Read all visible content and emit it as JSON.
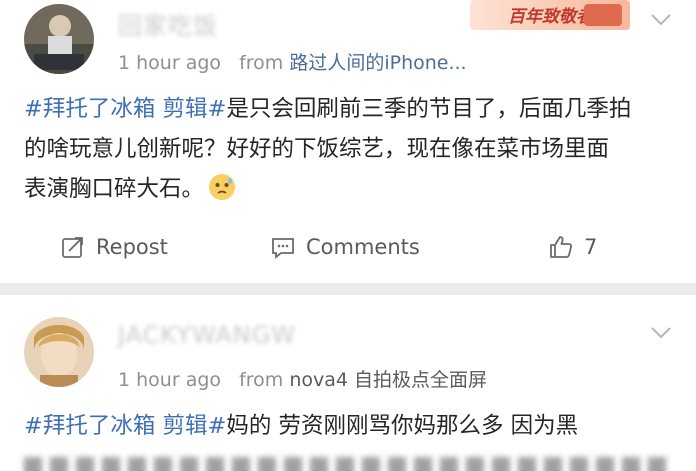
{
  "posts": [
    {
      "username": "回家吃饭",
      "time": "1 hour ago",
      "source_prefix": "from",
      "source_name": "路过人间的iPhone...",
      "badge": "百年致敬者",
      "topic": "#拜托了冰箱 剪辑#",
      "text_line_1_rest": "是只会回刷前三季的节目了，后面几季拍",
      "text_line_2": "的啥玩意儿创新呢？好好的下饭综艺，现在像在菜市场里面",
      "text_line_3": "表演胸口碎大石。",
      "emoji": "sweat-face-emoji",
      "actions": {
        "repost": "Repost",
        "comments": "Comments",
        "likes": "7"
      }
    },
    {
      "username": "JACKYWANGW",
      "time": "1 hour ago",
      "source_prefix": "from",
      "source_name": "nova4 自拍极点全面屏",
      "topic": "#拜托了冰箱 剪辑#",
      "text_line_1_rest": "妈的 劳资刚刚骂你妈那么多 因为黑"
    }
  ],
  "colors": {
    "topic": "#3f6fb7",
    "meta": "#8f8f8f",
    "separator": "#ececec",
    "text": "#262626"
  }
}
